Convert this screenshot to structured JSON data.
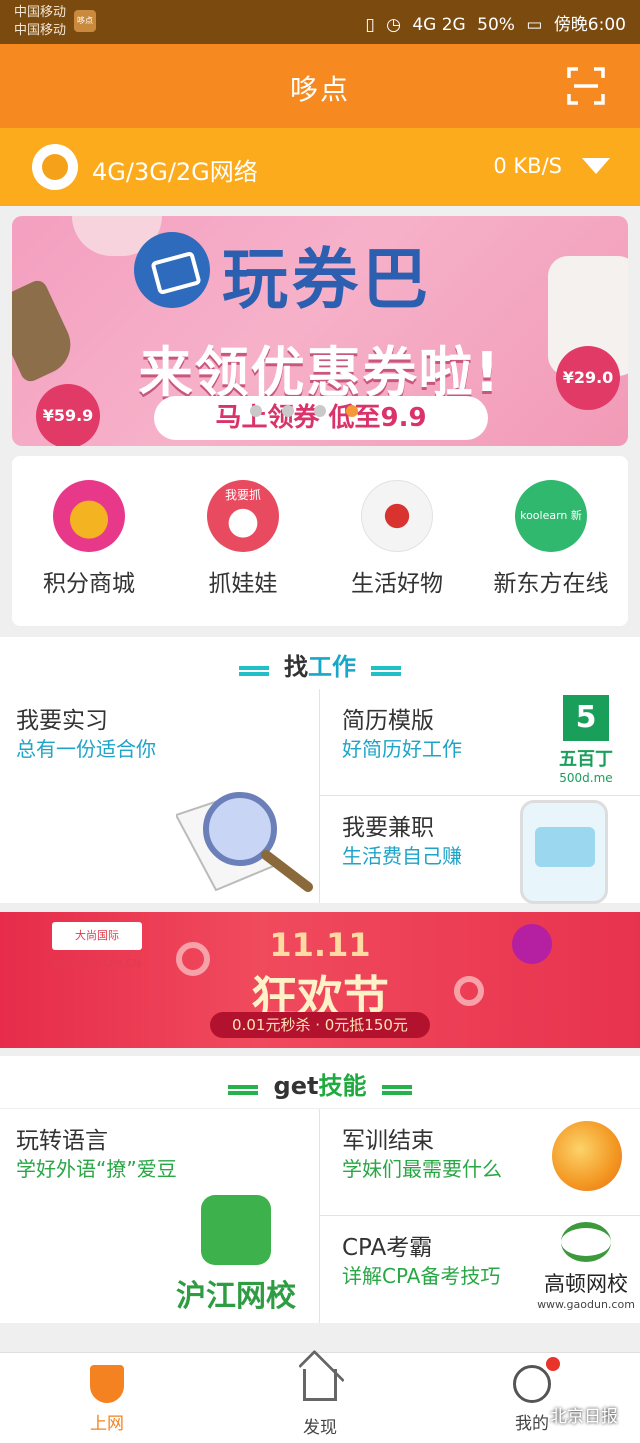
{
  "status": {
    "carrier1": "中国移动",
    "carrier2": "中国移动",
    "app_badge": "哆点",
    "signal": "4G 2G",
    "battery": "50%",
    "time": "傍晚6:00"
  },
  "header": {
    "title": "哆点"
  },
  "network": {
    "label": "4G/3G/2G网络",
    "speed": "0 KB/S"
  },
  "banner": {
    "title": "玩券巴",
    "subtitle": "来领优惠券啦!",
    "cta": "马上领券  低至9.9",
    "price_left": "¥59.9",
    "price_right": "¥29.0"
  },
  "shortcuts": [
    {
      "label": "积分商城"
    },
    {
      "label": "抓娃娃",
      "icon_text": "我要抓"
    },
    {
      "label": "生活好物"
    },
    {
      "label": "新东方在线",
      "icon_text": "koolearn 新东方在线"
    }
  ],
  "jobs": {
    "section_prefix": "找",
    "section_highlight": "工作",
    "internship": {
      "title": "我要实习",
      "subtitle": "总有一份适合你"
    },
    "resume": {
      "title": "简历模版",
      "subtitle": "好简历好工作",
      "logo_name": "五百丁",
      "logo_url": "500d.me"
    },
    "parttime": {
      "title": "我要兼职",
      "subtitle": "生活费自己赚"
    }
  },
  "ad": {
    "brand": "大尚国际 DUSUN.COM.CN",
    "line1": "11.11",
    "line2": "狂欢节",
    "promo": "0.01元秒杀 · 0元抵150元"
  },
  "skills": {
    "section_prefix": "get",
    "section_highlight": "技能",
    "language": {
      "title": "玩转语言",
      "subtitle": "学好外语“撩”爱豆",
      "logo_text": "沪江网校"
    },
    "training": {
      "title": "军训结束",
      "subtitle": "学妹们最需要什么"
    },
    "cpa": {
      "title": "CPA考霸",
      "subtitle": "详解CPA备考技巧",
      "logo_text": "高顿网校",
      "logo_url": "www.gaodun.com"
    }
  },
  "tabs": [
    {
      "label": "上网"
    },
    {
      "label": "发现"
    },
    {
      "label": "我的"
    }
  ],
  "watermark": "北京日报",
  "colors": {
    "header": "#f6891f",
    "netbar": "#fcab1d",
    "accent_blue": "#1ea4c8",
    "accent_green": "#2aa745",
    "tab_active": "#f58220"
  }
}
